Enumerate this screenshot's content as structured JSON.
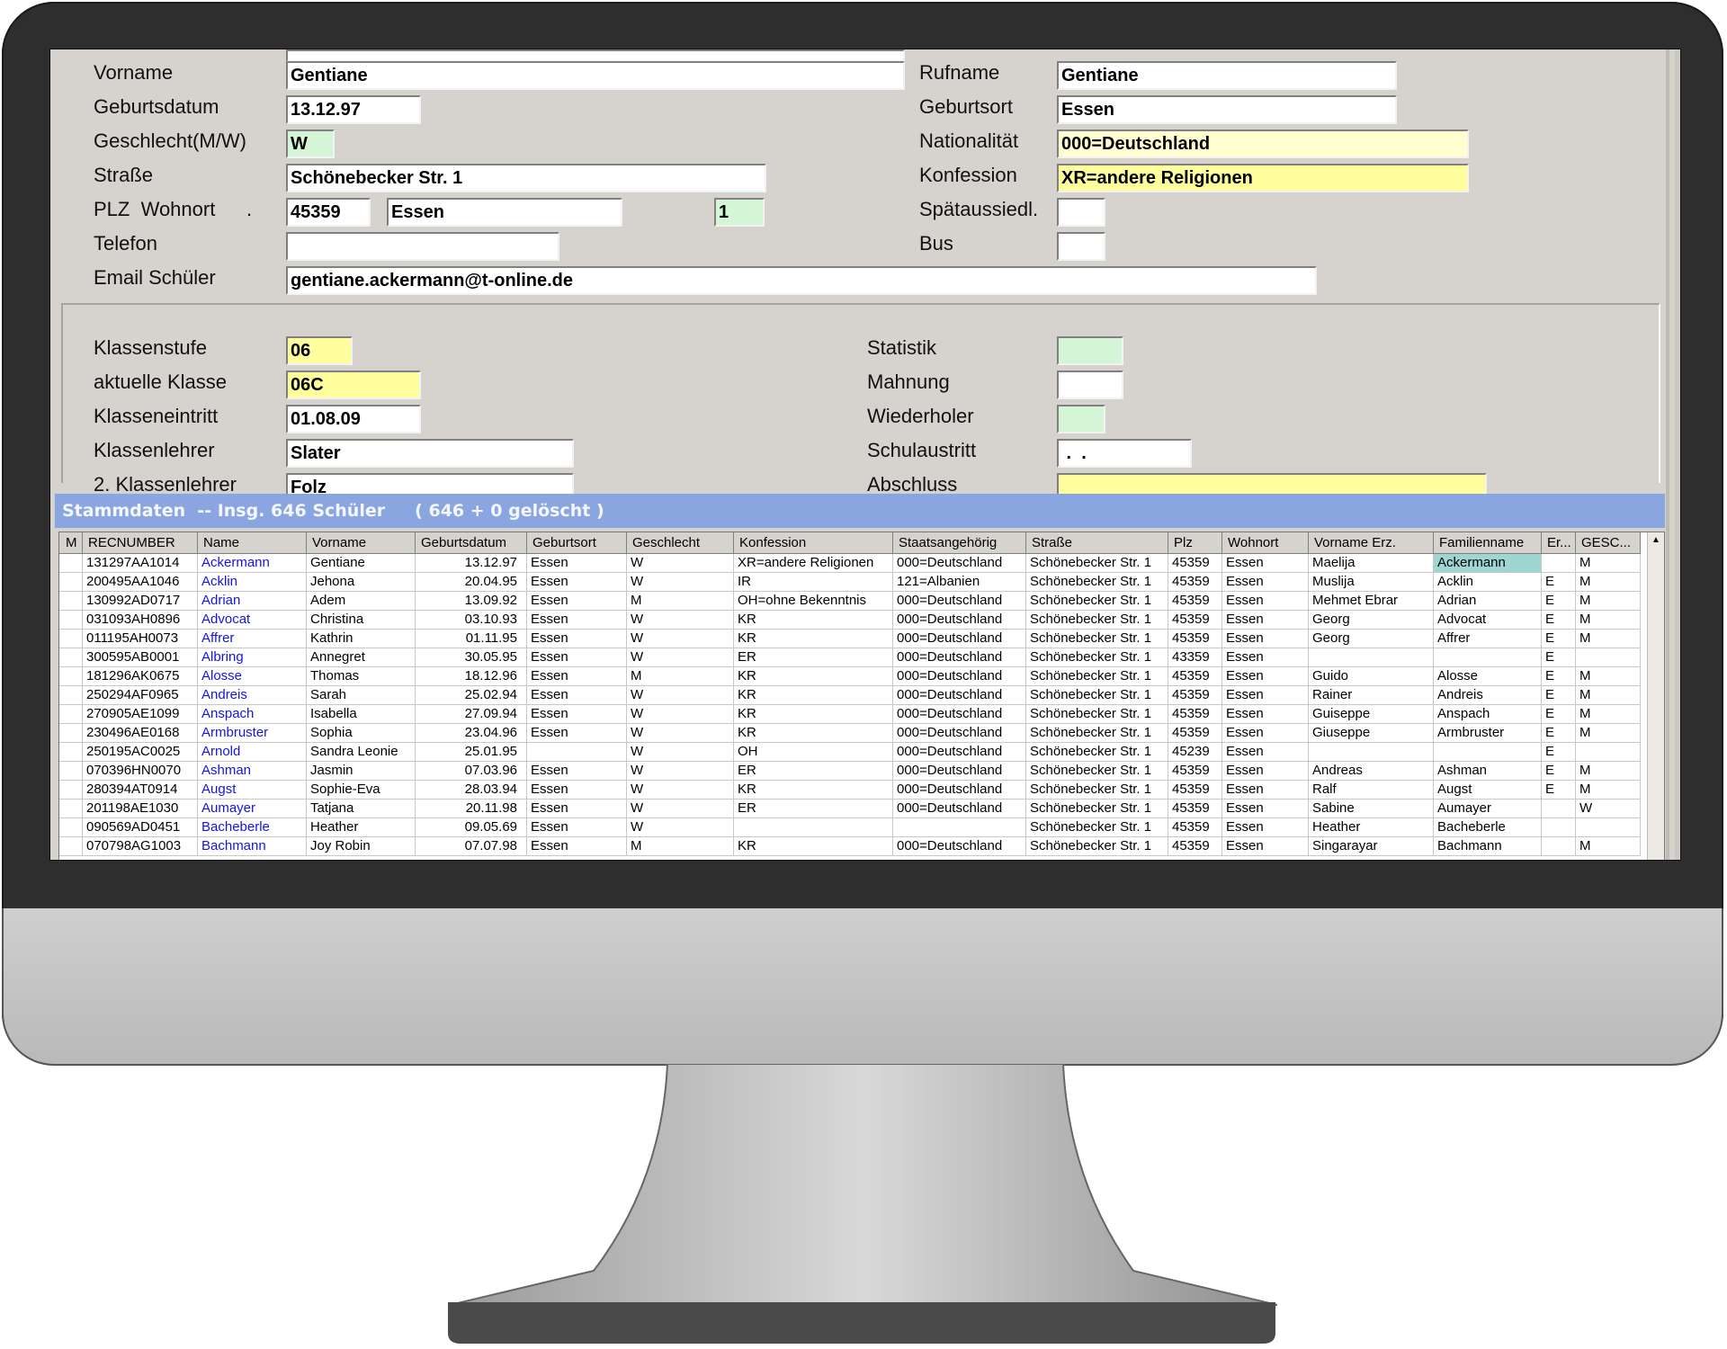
{
  "form": {
    "vorname": {
      "label": "Vorname",
      "value": "Gentiane"
    },
    "rufname": {
      "label": "Rufname",
      "value": "Gentiane"
    },
    "geburtsdatum": {
      "label": "Geburtsdatum",
      "value": "13.12.97"
    },
    "geburtsort": {
      "label": "Geburtsort",
      "value": "Essen"
    },
    "geschlecht": {
      "label": "Geschlecht(M/W)",
      "value": "W"
    },
    "nationalitaet": {
      "label": "Nationalität",
      "value": "000=Deutschland"
    },
    "strasse": {
      "label": "Straße",
      "value": "Schönebecker Str. 1"
    },
    "konfession": {
      "label": "Konfession",
      "value": "XR=andere Religionen"
    },
    "plz_wohnort": {
      "label": "PLZ  Wohnort",
      "dot": ".",
      "plz": "45359",
      "ort": "Essen",
      "extra": "1"
    },
    "spaetaussiedl": {
      "label": "Spätaussiedl.",
      "value": ""
    },
    "telefon": {
      "label": "Telefon",
      "value": ""
    },
    "bus": {
      "label": "Bus",
      "value": ""
    },
    "email": {
      "label": "Email Schüler",
      "value": "gentiane.ackermann@t-online.de"
    }
  },
  "klasse": {
    "klassenstufe": {
      "label": "Klassenstufe",
      "value": "06"
    },
    "statistik": {
      "label": "Statistik",
      "value": ""
    },
    "aktuelle_klasse": {
      "label": "aktuelle Klasse",
      "value": "06C"
    },
    "mahnung": {
      "label": "Mahnung",
      "value": ""
    },
    "klasseneintritt": {
      "label": "Klasseneintritt",
      "value": "01.08.09"
    },
    "wiederholer": {
      "label": "Wiederholer",
      "value": ""
    },
    "klassenlehrer": {
      "label": "Klassenlehrer",
      "value": "Slater"
    },
    "schulaustritt": {
      "label": "Schulaustritt",
      "value": " .  ."
    },
    "klassenlehrer2": {
      "label": "2. Klassenlehrer",
      "value": "Folz"
    },
    "abschluss": {
      "label": "Abschluss",
      "value": ""
    }
  },
  "grid": {
    "title": "Stammdaten  -- Insg. 646 Schüler     ( 646 + 0 gelöscht )",
    "columns": [
      "M",
      "RECNUMBER",
      "Name",
      "Vorname",
      "Geburtsdatum",
      "Geburtsort",
      "Geschlecht",
      "Konfession",
      "Staatsangehörig",
      "Straße",
      "Plz",
      "Wohnort",
      "Vorname Erz.",
      "Familienname",
      "Er...",
      "GESC..."
    ],
    "rows": [
      [
        "",
        "131297AA1014",
        "Ackermann",
        "Gentiane",
        "13.12.97",
        "Essen",
        "W",
        "XR=andere Religionen",
        "000=Deutschland",
        "Schönebecker Str. 1",
        "45359",
        "Essen",
        "Maelija",
        "Ackermann",
        "",
        "M"
      ],
      [
        "",
        "200495AA1046",
        "Acklin",
        "Jehona",
        "20.04.95",
        "Essen",
        "W",
        "IR",
        "121=Albanien",
        "Schönebecker Str. 1",
        "45359",
        "Essen",
        "Muslija",
        "Acklin",
        "E",
        "M"
      ],
      [
        "",
        "130992AD0717",
        "Adrian",
        "Adem",
        "13.09.92",
        "Essen",
        "M",
        "OH=ohne Bekenntnis",
        "000=Deutschland",
        "Schönebecker Str. 1",
        "45359",
        "Essen",
        "Mehmet Ebrar",
        "Adrian",
        "E",
        "M"
      ],
      [
        "",
        "031093AH0896",
        "Advocat",
        "Christina",
        "03.10.93",
        "Essen",
        "W",
        "KR",
        "000=Deutschland",
        "Schönebecker Str. 1",
        "45359",
        "Essen",
        "Georg",
        "Advocat",
        "E",
        "M"
      ],
      [
        "",
        "011195AH0073",
        "Affrer",
        "Kathrin",
        "01.11.95",
        "Essen",
        "W",
        "KR",
        "000=Deutschland",
        "Schönebecker Str. 1",
        "45359",
        "Essen",
        "Georg",
        "Affrer",
        "E",
        "M"
      ],
      [
        "",
        "300595AB0001",
        "Albring",
        "Annegret",
        "30.05.95",
        "Essen",
        "W",
        "ER",
        "000=Deutschland",
        "Schönebecker Str. 1",
        "43359",
        "Essen",
        "",
        "",
        "E",
        ""
      ],
      [
        "",
        "181296AK0675",
        "Alosse",
        "Thomas",
        "18.12.96",
        "Essen",
        "M",
        "KR",
        "000=Deutschland",
        "Schönebecker Str. 1",
        "45359",
        "Essen",
        "Guido",
        "Alosse",
        "E",
        "M"
      ],
      [
        "",
        "250294AF0965",
        "Andreis",
        "Sarah",
        "25.02.94",
        "Essen",
        "W",
        "KR",
        "000=Deutschland",
        "Schönebecker Str. 1",
        "45359",
        "Essen",
        "Rainer",
        "Andreis",
        "E",
        "M"
      ],
      [
        "",
        "270905AE1099",
        "Anspach",
        "Isabella",
        "27.09.94",
        "Essen",
        "W",
        "KR",
        "000=Deutschland",
        "Schönebecker Str. 1",
        "45359",
        "Essen",
        "Guiseppe",
        "Anspach",
        "E",
        "M"
      ],
      [
        "",
        "230496AE0168",
        "Armbruster",
        "Sophia",
        "23.04.96",
        "Essen",
        "W",
        "KR",
        "000=Deutschland",
        "Schönebecker Str. 1",
        "45359",
        "Essen",
        "Giuseppe",
        "Armbruster",
        "E",
        "M"
      ],
      [
        "",
        "250195AC0025",
        "Arnold",
        "Sandra Leonie",
        "25.01.95",
        "",
        "W",
        "OH",
        "000=Deutschland",
        "Schönebecker Str. 1",
        "45239",
        "Essen",
        "",
        "",
        "E",
        ""
      ],
      [
        "",
        "070396HN0070",
        "Ashman",
        "Jasmin",
        "07.03.96",
        "Essen",
        "W",
        "ER",
        "000=Deutschland",
        "Schönebecker Str. 1",
        "45359",
        "Essen",
        "Andreas",
        "Ashman",
        "E",
        "M"
      ],
      [
        "",
        "280394AT0914",
        "Augst",
        "Sophie-Eva",
        "28.03.94",
        "Essen",
        "W",
        "KR",
        "000=Deutschland",
        "Schönebecker Str. 1",
        "45359",
        "Essen",
        "Ralf",
        "Augst",
        "E",
        "M"
      ],
      [
        "",
        "201198AE1030",
        "Aumayer",
        "Tatjana",
        "20.11.98",
        "Essen",
        "W",
        "ER",
        "000=Deutschland",
        "Schönebecker Str. 1",
        "45359",
        "Essen",
        "Sabine",
        "Aumayer",
        "",
        "W"
      ],
      [
        "",
        "090569AD0451",
        "Bacheberle",
        "Heather",
        "09.05.69",
        "Essen",
        "W",
        "",
        "",
        "Schönebecker Str. 1",
        "45359",
        "Essen",
        "Heather",
        "Bacheberle",
        "",
        ""
      ],
      [
        "",
        "070798AG1003",
        "Bachmann",
        "Joy Robin",
        "07.07.98",
        "Essen",
        "M",
        "KR",
        "000=Deutschland",
        "Schönebecker Str. 1",
        "45359",
        "Essen",
        "Singarayar",
        "Bachmann",
        "",
        "M"
      ]
    ]
  }
}
